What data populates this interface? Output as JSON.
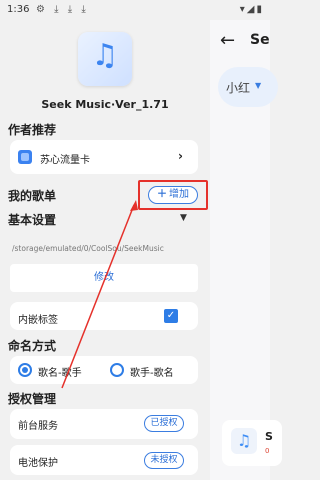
{
  "status_bar": {
    "time": "1:36",
    "left_icons": "⚙ ⤓ ⤓ ⤓",
    "right_icons": "▾◢▮"
  },
  "background_page": {
    "title": "Se",
    "user_dropdown": "小红",
    "music_card_letter": "S",
    "music_card_sub": "0"
  },
  "app": {
    "name": "Seek Music·Ver_1.71",
    "logo_label": "Seek Music"
  },
  "sections": {
    "author_recommend": "作者推荐",
    "my_playlist": "我的歌单",
    "basic_settings": "基本设置",
    "naming": "命名方式",
    "authorization": "授权管理"
  },
  "recommend_item": {
    "label": "苏心流量卡"
  },
  "add_button": {
    "label": "增加"
  },
  "storage_path": "/storage/emulated/0/CoolSou/SeekMusic",
  "modify_button": "修改",
  "embed_lyrics": {
    "label": "内嵌标签",
    "checked": true
  },
  "naming_options": [
    {
      "label": "歌名-歌手",
      "selected": true
    },
    {
      "label": "歌手-歌名",
      "selected": false
    }
  ],
  "auth_items": [
    {
      "label": "前台服务",
      "status": "已授权"
    },
    {
      "label": "电池保护",
      "status": "未授权"
    }
  ],
  "colors": {
    "accent": "#2e7de6",
    "highlight": "#e5312b"
  }
}
